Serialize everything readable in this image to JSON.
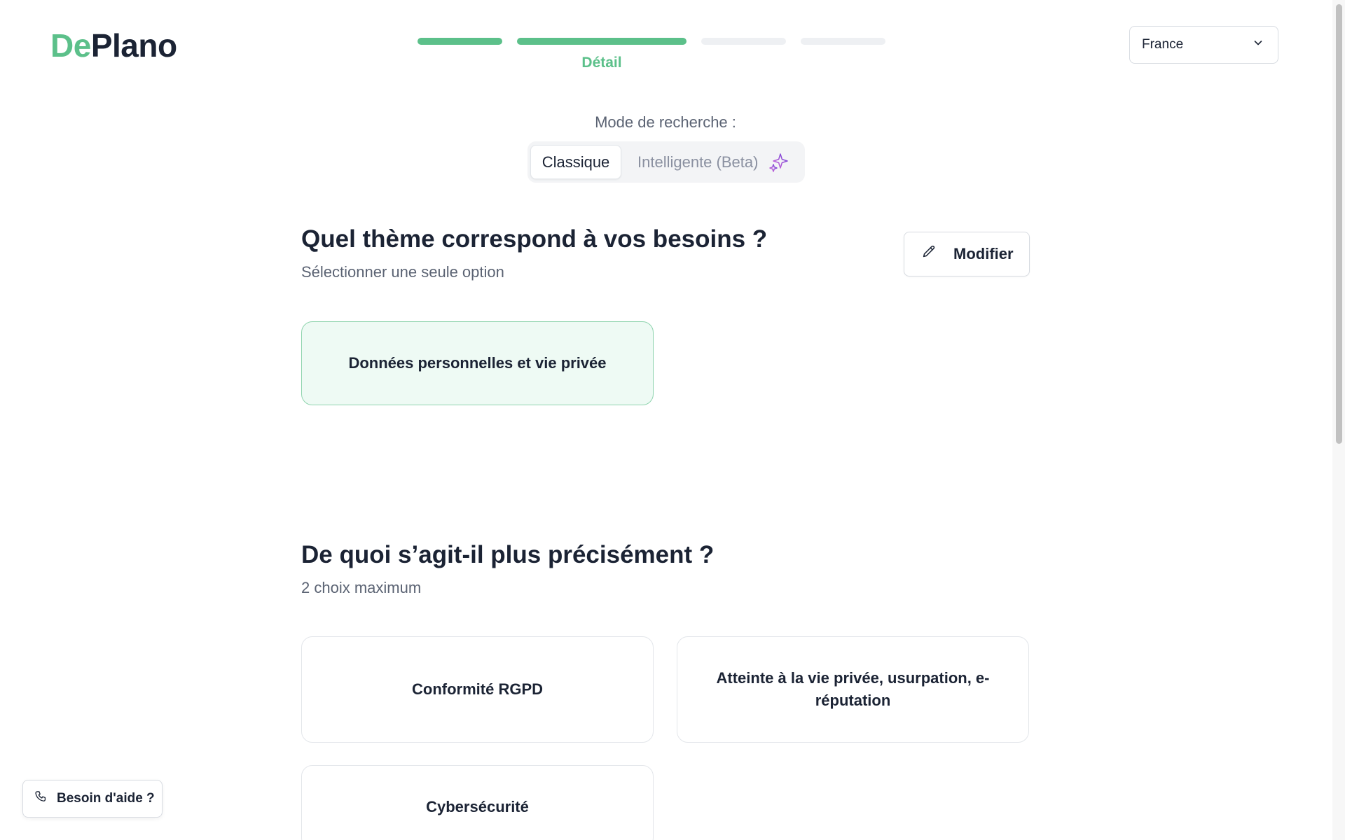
{
  "logo": {
    "part1": "De",
    "part2": "Plano"
  },
  "stepper": {
    "current_label": "Détail",
    "steps": [
      "done",
      "done",
      "pending",
      "pending"
    ]
  },
  "country_select": {
    "value": "France",
    "icon": "chevron-down-icon"
  },
  "search_mode": {
    "label": "Mode de recherche :",
    "options": [
      {
        "label": "Classique",
        "active": true
      },
      {
        "label": "Intelligente (Beta)",
        "active": false,
        "icon": "sparkle-icon"
      }
    ]
  },
  "theme_section": {
    "title": "Quel thème correspond à vos besoins ?",
    "subtitle": "Sélectionner une seule option",
    "edit_label": "Modifier",
    "selected": "Données personnelles et vie privée"
  },
  "detail_section": {
    "title": "De quoi s’agit-il plus précisément ?",
    "subtitle": "2 choix maximum",
    "options": [
      "Conformité RGPD",
      "Atteinte à la vie privée, usurpation, e-réputation",
      "Cybersécurité"
    ]
  },
  "help": {
    "label": "Besoin d'aide ?",
    "icon": "phone-icon"
  },
  "colors": {
    "brand_green": "#5cc08a",
    "brand_dark": "#1b2334",
    "selected_bg": "#eefaf4",
    "accent_purple": "#9b3fd1"
  }
}
